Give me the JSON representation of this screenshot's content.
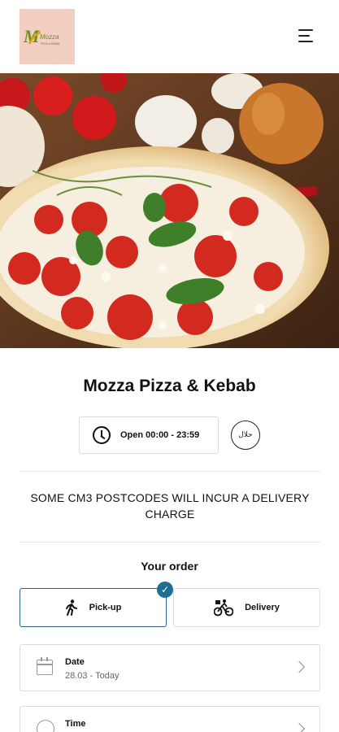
{
  "header": {
    "logo_text": "Mozza",
    "logo_sub": "PIZZA & KEBAB",
    "menu_icon": "hamburger-menu-icon"
  },
  "restaurant": {
    "name": "Mozza Pizza & Kebab",
    "hours": "Open 00:00 - 23:59",
    "halal_text": "حلال",
    "notice": "SOME CM3 POSTCODES WILL INCUR A DELIVERY CHARGE"
  },
  "order": {
    "title": "Your order",
    "modes": [
      {
        "label": "Pick-up",
        "icon": "walking-person-icon",
        "selected": true
      },
      {
        "label": "Delivery",
        "icon": "bicycle-courier-icon",
        "selected": false
      }
    ],
    "date": {
      "label": "Date",
      "value": "28.03 - Today"
    },
    "time": {
      "label": "Time"
    }
  },
  "colors": {
    "accent": "#1f6f93",
    "selected_border": "#2d5f87",
    "logo_bg": "#f2cfc0"
  }
}
